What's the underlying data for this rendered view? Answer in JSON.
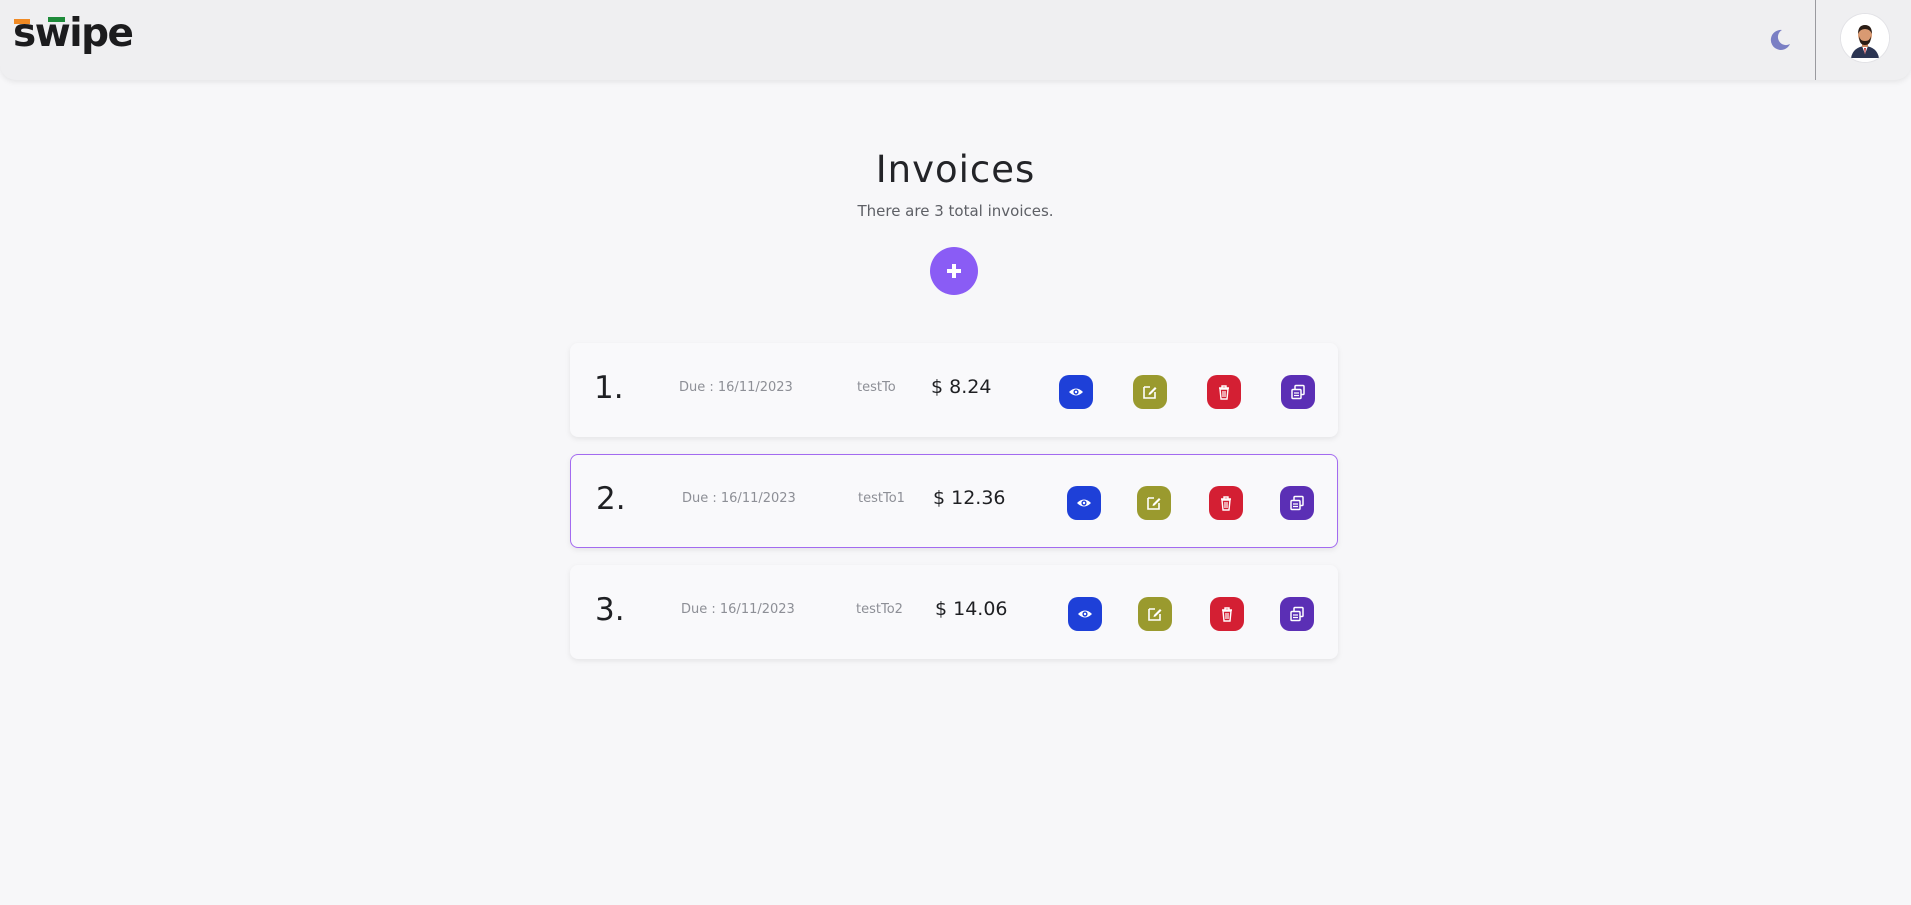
{
  "header": {
    "logo_text": "swipe",
    "logo_colors": {
      "orange": "#f08a24",
      "green": "#1e8b3a"
    },
    "theme_toggle_icon": "moon-icon",
    "avatar_icon": "user-avatar-icon"
  },
  "main": {
    "title": "Invoices",
    "subtitle": "There are 3 total invoices.",
    "add_button_icon": "plus-icon",
    "accent_color": "#8a5cf5"
  },
  "invoices": [
    {
      "number": "1.",
      "due": "Due : 16/11/2023",
      "to": "testTo",
      "amount": "$ 8.24",
      "selected": false
    },
    {
      "number": "2.",
      "due": "Due : 16/11/2023",
      "to": "testTo1",
      "amount": "$ 12.36",
      "selected": true
    },
    {
      "number": "3.",
      "due": "Due : 16/11/2023",
      "to": "testTo2",
      "amount": "$ 14.06",
      "selected": false
    }
  ],
  "actions": [
    {
      "name": "view",
      "icon": "eye-icon",
      "color": "#1e40d8"
    },
    {
      "name": "edit",
      "icon": "edit-icon",
      "color": "#9a9a2e"
    },
    {
      "name": "delete",
      "icon": "trash-icon",
      "color": "#d41f33"
    },
    {
      "name": "copy",
      "icon": "copy-icon",
      "color": "#5b2fb5"
    }
  ]
}
